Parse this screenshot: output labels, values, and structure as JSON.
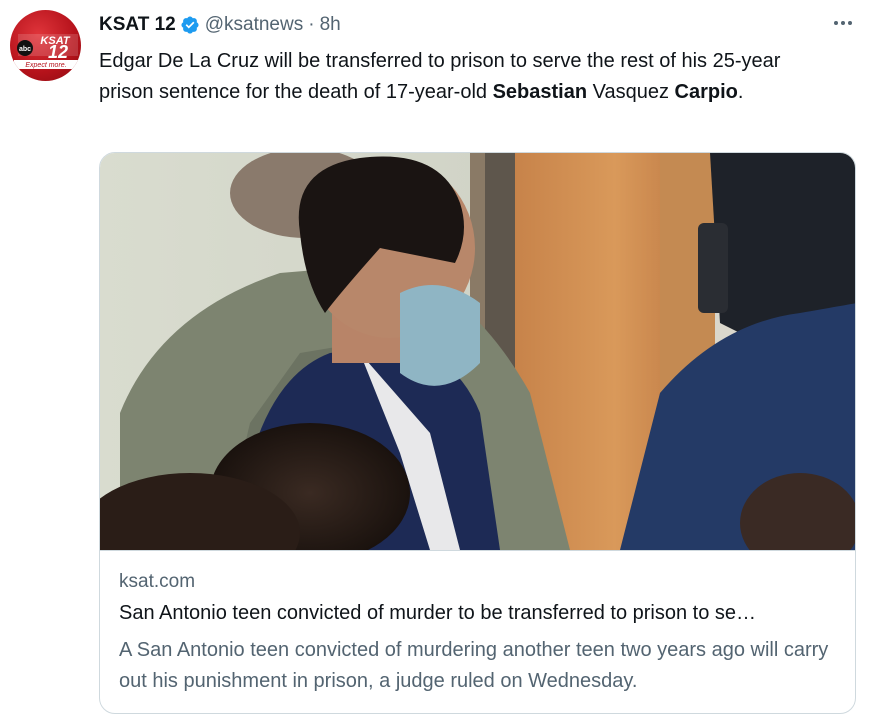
{
  "author": {
    "name": "KSAT 12",
    "handle": "@ksatnews",
    "separator": "·",
    "time": "8h",
    "verified": true,
    "avatar_icon": "ksat12-logo-icon",
    "avatar_logo_text": "KSAT 12 abc Expect more."
  },
  "tweet": {
    "text_part1": "Edgar De La Cruz will be transferred to prison to serve the rest of his 25-year prison sentence for the death of 17-year-old ",
    "bold1": "Sebastian",
    "text_part2": " Vasquez ",
    "bold2": "Carpio",
    "text_part3": "."
  },
  "card": {
    "image_icon": "courtroom-photo",
    "domain": "ksat.com",
    "title": "San Antonio teen convicted of murder to be transferred to prison to se…",
    "description": "A San Antonio teen convicted of murdering another teen two years ago will carry out his punishment in prison, a judge ruled on Wednesday."
  },
  "menu": {
    "icon": "more-horizontal-icon"
  },
  "colors": {
    "verified_blue": "#1d9bf0",
    "secondary_text": "#536471",
    "brand_red": "#c4161c"
  }
}
